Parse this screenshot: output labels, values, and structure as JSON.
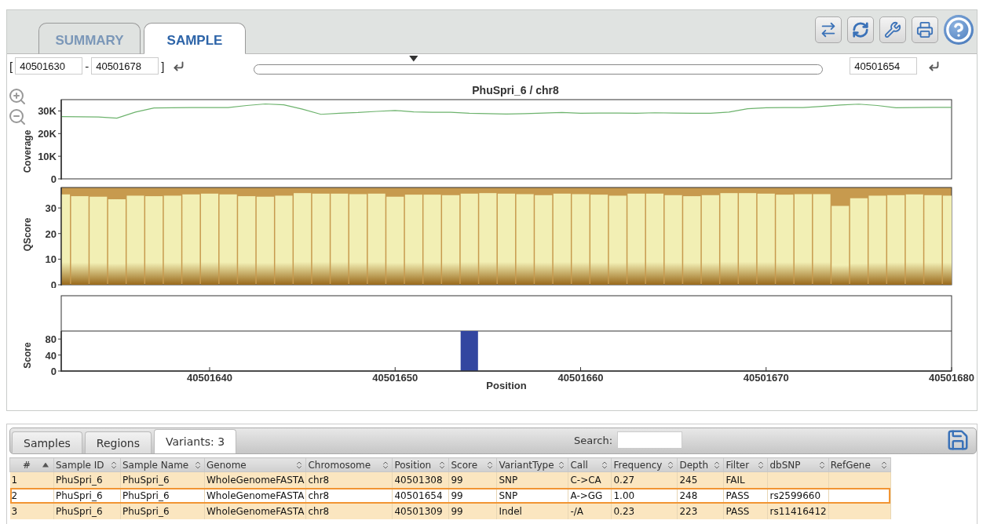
{
  "top_tabs": [
    {
      "label": "SUMMARY",
      "selected": false
    },
    {
      "label": "SAMPLE",
      "selected": true
    }
  ],
  "range": {
    "open": "[",
    "start": "40501630",
    "dash": "-",
    "end": "40501678",
    "close": "]"
  },
  "navigator": {
    "level": 0.28
  },
  "position_field": {
    "value": "40501654"
  },
  "chart_title": "PhuSpri_6 / chr8",
  "coverage": {
    "chart_data": {
      "type": "line",
      "ylabel": "Coverage",
      "xlim": [
        40501632,
        40501680
      ],
      "ylim": [
        0,
        35000
      ],
      "yticks": [
        {
          "value": 0,
          "label": "0"
        },
        {
          "value": 10000,
          "label": "10K"
        },
        {
          "value": 20000,
          "label": "20K"
        },
        {
          "value": 30000,
          "label": "30K"
        }
      ],
      "x": [
        40501632,
        40501633,
        40501634,
        40501635,
        40501636,
        40501637,
        40501638,
        40501639,
        40501640,
        40501641,
        40501642,
        40501643,
        40501644,
        40501645,
        40501646,
        40501647,
        40501648,
        40501649,
        40501650,
        40501651,
        40501652,
        40501653,
        40501654,
        40501655,
        40501656,
        40501657,
        40501658,
        40501659,
        40501660,
        40501661,
        40501662,
        40501663,
        40501664,
        40501665,
        40501666,
        40501667,
        40501668,
        40501669,
        40501670,
        40501671,
        40501672,
        40501673,
        40501674,
        40501675,
        40501676,
        40501677,
        40501678,
        40501679,
        40501680
      ],
      "series": [
        {
          "color": "#6db36d",
          "values": [
            27500,
            27400,
            27300,
            26800,
            29500,
            31300,
            31400,
            31500,
            31500,
            31500,
            32400,
            33100,
            32700,
            30800,
            28500,
            29000,
            29300,
            29800,
            30200,
            29600,
            29400,
            29400,
            29000,
            28800,
            28600,
            28800,
            29100,
            29300,
            29000,
            29100,
            29100,
            29000,
            29200,
            29100,
            29000,
            29000,
            29500,
            31000,
            31400,
            31500,
            31500,
            32000,
            32600,
            33000,
            32400,
            31400,
            31500,
            31600,
            31600
          ]
        }
      ]
    }
  },
  "qscore": {
    "chart_data": {
      "type": "bar",
      "ylabel": "QScore",
      "xlim": [
        40501632,
        40501680
      ],
      "ylim": [
        0,
        38
      ],
      "yticks": [
        0,
        10,
        20,
        30
      ],
      "x": [
        40501632,
        40501633,
        40501634,
        40501635,
        40501636,
        40501637,
        40501638,
        40501639,
        40501640,
        40501641,
        40501642,
        40501643,
        40501644,
        40501645,
        40501646,
        40501647,
        40501648,
        40501649,
        40501650,
        40501651,
        40501652,
        40501653,
        40501654,
        40501655,
        40501656,
        40501657,
        40501658,
        40501659,
        40501660,
        40501661,
        40501662,
        40501663,
        40501664,
        40501665,
        40501666,
        40501667,
        40501668,
        40501669,
        40501670,
        40501671,
        40501672,
        40501673,
        40501674,
        40501675,
        40501676,
        40501677,
        40501678,
        40501679,
        40501680
      ],
      "series": [
        {
          "color": "#f2efb4",
          "values": [
            35.3,
            34.6,
            34.4,
            33.4,
            34.8,
            34.6,
            34.8,
            35.3,
            35.6,
            35.3,
            34.6,
            34.4,
            34.8,
            35.8,
            35.6,
            35.6,
            35.4,
            35.6,
            34.4,
            35.2,
            35.2,
            35.0,
            35.6,
            35.8,
            35.6,
            35.4,
            35.0,
            35.6,
            35.4,
            35.2,
            34.8,
            35.6,
            35.6,
            35.0,
            34.6,
            35.0,
            35.8,
            35.8,
            35.6,
            35.2,
            35.4,
            35.4,
            30.8,
            33.8,
            34.8,
            35.0,
            35.3,
            35.0,
            34.8
          ]
        }
      ]
    }
  },
  "score": {
    "chart_data": {
      "type": "bar",
      "xlabel": "Position",
      "ylabel": "Score",
      "xlim": [
        40501632,
        40501680
      ],
      "ylim": [
        0,
        100
      ],
      "yticks": [
        0,
        40,
        80
      ],
      "xticks": [
        40501640,
        40501650,
        40501660,
        40501670,
        40501680
      ],
      "x": [
        40501654
      ],
      "series": [
        {
          "color": "#3346a0",
          "values": [
            100
          ]
        }
      ]
    }
  },
  "bottom_tabs": [
    {
      "label": "Samples",
      "selected": false
    },
    {
      "label": "Regions",
      "selected": false
    },
    {
      "label": "Variants: 3",
      "selected": true
    }
  ],
  "search": {
    "label": "Search:"
  },
  "table": {
    "columns": [
      {
        "label": "#",
        "sorted": true
      },
      {
        "label": "Sample ID",
        "sorted": false
      },
      {
        "label": "Sample Name",
        "sorted": false
      },
      {
        "label": "Genome",
        "sorted": false
      },
      {
        "label": "Chromosome",
        "sorted": false
      },
      {
        "label": "Position",
        "sorted": false
      },
      {
        "label": "Score",
        "sorted": false
      },
      {
        "label": "VariantType",
        "sorted": false
      },
      {
        "label": "Call",
        "sorted": false
      },
      {
        "label": "Frequency",
        "sorted": false
      },
      {
        "label": "Depth",
        "sorted": false
      },
      {
        "label": "Filter",
        "sorted": false
      },
      {
        "label": "dbSNP",
        "sorted": false
      },
      {
        "label": "RefGene",
        "sorted": false
      }
    ],
    "rows": [
      {
        "selected": false,
        "cells": [
          "1",
          "PhuSpri_6",
          "PhuSpri_6",
          "WholeGenomeFASTA",
          "chr8",
          "40501308",
          "99",
          "SNP",
          "C->CA",
          "0.27",
          "245",
          "FAIL",
          "",
          ""
        ]
      },
      {
        "selected": true,
        "cells": [
          "2",
          "PhuSpri_6",
          "PhuSpri_6",
          "WholeGenomeFASTA",
          "chr8",
          "40501654",
          "99",
          "SNP",
          "A->GG",
          "1.00",
          "248",
          "PASS",
          "rs2599660",
          ""
        ]
      },
      {
        "selected": false,
        "cells": [
          "3",
          "PhuSpri_6",
          "PhuSpri_6",
          "WholeGenomeFASTA",
          "chr8",
          "40501309",
          "99",
          "Indel",
          "-/A",
          "0.23",
          "223",
          "PASS",
          "rs11416412",
          ""
        ]
      }
    ]
  }
}
